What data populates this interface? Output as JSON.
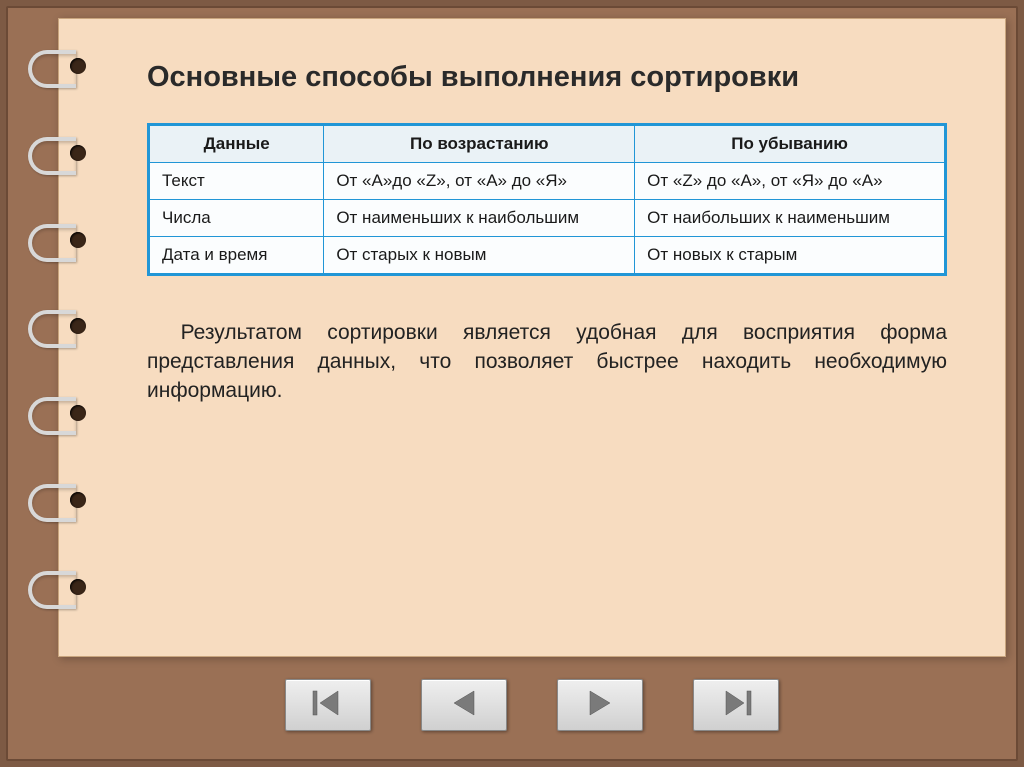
{
  "title": "Основные способы выполнения сортировки",
  "table": {
    "headers": [
      "Данные",
      "По возрастанию",
      "По убыванию"
    ],
    "rows": [
      {
        "c0": "Текст",
        "c1": "От «A»до «Z», от «А» до «Я»",
        "c2": "От «Z» до «A», от «Я» до «А»"
      },
      {
        "c0": "Числа",
        "c1": "От наименьших к наибольшим",
        "c2": "От наибольших к наименьшим"
      },
      {
        "c0": "Дата и время",
        "c1": "От старых к новым",
        "c2": "От новых к старым"
      }
    ]
  },
  "summary": "Результатом сортировки является удобная для восприятия форма представления данных, что позволяет быстрее находить необходимую информацию."
}
